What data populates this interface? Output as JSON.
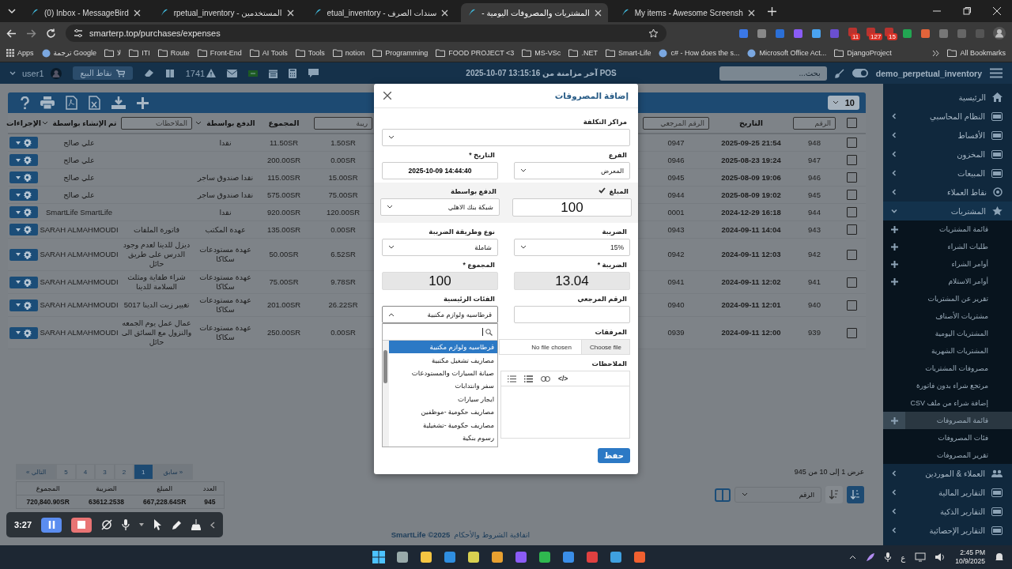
{
  "browser": {
    "tabs": [
      {
        "title": "My items - Awesome Screensh",
        "selected": false
      },
      {
        "title": "المشتريات والمصروفات اليومية -",
        "selected": true
      },
      {
        "title": "سندات الصرف - etual_inventory",
        "selected": false
      },
      {
        "title": "المستخدمين - rpetual_inventory",
        "selected": false
      },
      {
        "title": "(0) Inbox - MessageBird",
        "selected": false
      }
    ],
    "address": "smarterp.top/purchases/expenses",
    "extension_badges": [
      "15",
      "127",
      "11"
    ],
    "bookmarks": [
      {
        "label": "DjangoProject",
        "kind": "folder"
      },
      {
        "label": "Microsoft Office Act...",
        "kind": "site"
      },
      {
        "label": "c# - How does the s...",
        "kind": "site"
      },
      {
        "label": "Smart-Life",
        "kind": "folder"
      },
      {
        "label": ".NET",
        "kind": "folder"
      },
      {
        "label": "MS-VSc",
        "kind": "folder"
      },
      {
        "label": "FOOD PROJECT <3",
        "kind": "folder"
      },
      {
        "label": "Programming",
        "kind": "folder"
      },
      {
        "label": "notion",
        "kind": "folder"
      },
      {
        "label": "Tools",
        "kind": "folder"
      },
      {
        "label": "AI Tools",
        "kind": "folder"
      },
      {
        "label": "Front-End",
        "kind": "folder"
      },
      {
        "label": "Route",
        "kind": "folder"
      },
      {
        "label": "ITI",
        "kind": "folder"
      },
      {
        "label": "لا",
        "kind": "folder"
      },
      {
        "label": "ترجمة Google",
        "kind": "site"
      },
      {
        "label": "Apps",
        "kind": "apps"
      }
    ],
    "all_bookmarks": "All Bookmarks"
  },
  "header": {
    "company": "demo_perpetual_inventory",
    "toggle_on": true,
    "search_placeholder": "بحث...",
    "sync": "2025-10-07 13:15:16 آخر مزامنة من POS",
    "alert_count": "1741",
    "pos_button": "نقاط البيع",
    "user": "user1"
  },
  "sidebar": {
    "items": [
      {
        "label": "الرئيسية",
        "expandable": false,
        "expanded": false
      },
      {
        "label": "النظام المحاسبي",
        "expandable": true,
        "expanded": false
      },
      {
        "label": "الأقساط",
        "expandable": true,
        "expanded": false
      },
      {
        "label": "المخزون",
        "expandable": true,
        "expanded": false
      },
      {
        "label": "المبيعات",
        "expandable": true,
        "expanded": false
      },
      {
        "label": "نقاط العملاء",
        "expandable": true,
        "expanded": false
      },
      {
        "label": "المشتريات",
        "expandable": true,
        "expanded": true,
        "children": [
          {
            "label": "قائمة المشتريات",
            "add": true,
            "selected": false
          },
          {
            "label": "طلبات الشراء",
            "add": true,
            "selected": false
          },
          {
            "label": "أوامر الشراء",
            "add": true,
            "selected": false
          },
          {
            "label": "أوامر الاستلام",
            "add": true,
            "selected": false
          },
          {
            "label": "تقرير عن المشتريات",
            "add": false,
            "selected": false
          },
          {
            "label": "مشتريات الأصناف",
            "add": false,
            "selected": false
          },
          {
            "label": "المشتريات اليومية",
            "add": false,
            "selected": false
          },
          {
            "label": "المشتريات الشهرية",
            "add": false,
            "selected": false
          },
          {
            "label": "مصروفات المشتريات",
            "add": false,
            "selected": false
          },
          {
            "label": "مرتجع شراء بدون فاتورة",
            "add": false,
            "selected": false
          },
          {
            "label": "إضافة شراء من ملف CSV",
            "add": false,
            "selected": false
          },
          {
            "label": "قائمة المصروفات",
            "add": true,
            "selected": true
          },
          {
            "label": "فئات المصروفات",
            "add": false,
            "selected": false
          },
          {
            "label": "تقرير المصروفات",
            "add": false,
            "selected": false
          }
        ]
      },
      {
        "label": "العملاء & الموردين",
        "expandable": true,
        "expanded": false
      },
      {
        "label": "التقارير المالية",
        "expandable": true,
        "expanded": false
      },
      {
        "label": "التقارير الذكية",
        "expandable": true,
        "expanded": false
      },
      {
        "label": "التقارير الإحصائية",
        "expandable": true,
        "expanded": false
      }
    ]
  },
  "table": {
    "page_size": "10",
    "columns": [
      {
        "kind": "checkbox",
        "checked": false
      },
      {
        "placeholder": "الرقم",
        "kind": "filter"
      },
      {
        "label": "التاريخ",
        "kind": "plain"
      },
      {
        "placeholder": "الرقم المرجعي",
        "kind": "filter"
      },
      {
        "placeholder": "ريبة",
        "kind": "filter"
      },
      {
        "label": "المجموع",
        "kind": "plain"
      },
      {
        "label": "الدفع بواسطة",
        "kind": "select"
      },
      {
        "placeholder": "الملاحظات",
        "kind": "filter"
      },
      {
        "label": "تم الإنشاء بواسطة",
        "kind": "select"
      },
      {
        "label": "الإجراءات",
        "kind": "plain"
      }
    ],
    "rows": [
      {
        "checked": false,
        "number": "948",
        "date": "2025-09-25 21:54",
        "ref": "0947",
        "tax": "1.50SR",
        "total": "11.50SR",
        "payment": "نقدا",
        "created_by": "علي صالح"
      },
      {
        "checked": false,
        "number": "947",
        "date": "2025-08-23 19:24",
        "ref": "0946",
        "tax": "0.00SR",
        "total": "200.00SR",
        "created_by": "علي صالح"
      },
      {
        "checked": false,
        "number": "946",
        "date": "2025-08-09 19:06",
        "ref": "0945",
        "tax": "15.00SR",
        "total": "115.00SR",
        "payment": "نقدا صندوق ساجر",
        "created_by": "علي صالح"
      },
      {
        "checked": false,
        "number": "945",
        "date": "2025-08-09 19:02",
        "ref": "0944",
        "tax": "75.00SR",
        "total": "575.00SR",
        "payment": "نقدا صندوق ساجر",
        "created_by": "علي صالح"
      },
      {
        "checked": false,
        "number": "944",
        "date": "2024-12-29 16:18",
        "ref": "0001",
        "tax": "120.00SR",
        "total": "920.00SR",
        "payment": "نقدا",
        "created_by": "SmartLife SmartLife"
      },
      {
        "checked": false,
        "number": "943",
        "date": "2024-09-11 14:04",
        "ref": "0943",
        "tax": "0.00SR",
        "total": "135.00SR",
        "payment": "عهدة المكتب",
        "notes": "فاتورة الملفات",
        "created_by": "SARAH ALMAHMOUDI"
      },
      {
        "checked": false,
        "number": "942",
        "date": "2024-09-11 12:03",
        "ref": "0942",
        "tax": "6.52SR",
        "total": "50.00SR",
        "payment": "عهدة مستودعات سكاكا",
        "notes": "ديزل للدينا لعدم وجود الدرس على طريق حائل",
        "created_by": "SARAH ALMAHMOUDI"
      },
      {
        "checked": false,
        "number": "941",
        "date": "2024-09-11 12:02",
        "ref": "0941",
        "tax": "9.78SR",
        "total": "75.00SR",
        "payment": "عهدة مستودعات سكاكا",
        "notes": "شراء طفاية ومثلث السلامة للدينا",
        "created_by": "SARAH ALMAHMOUDI"
      },
      {
        "checked": false,
        "number": "940",
        "date": "2024-09-11 12:01",
        "ref": "0940",
        "tax": "26.22SR",
        "total": "201.00SR",
        "payment": "عهدة مستودعات سكاكا",
        "notes": "تغيير زيت الدينا 5017",
        "created_by": "SARAH ALMAHMOUDI"
      },
      {
        "checked": false,
        "number": "939",
        "date": "2024-09-11 12:00",
        "ref": "0939",
        "tax": "0.00SR",
        "total": "250.00SR",
        "payment": "عهدة مستودعات سكاكا",
        "notes": "عمال عمل يوم الجمعه والنزول مع السائق الى حائل",
        "created_by": "SARAH ALMAHMOUDI"
      }
    ],
    "info": "عرض 1 إلى 10 من 945",
    "pagination": [
      {
        "label": "« سابق",
        "selected": false
      },
      {
        "label": "1",
        "selected": true
      },
      {
        "label": "2",
        "selected": false
      },
      {
        "label": "3",
        "selected": false
      },
      {
        "label": "4",
        "selected": false
      },
      {
        "label": "5",
        "selected": false
      },
      {
        "label": "التالي »",
        "selected": false
      }
    ],
    "summary": {
      "headers": [
        "العدد",
        "المبلغ",
        "الضريبة",
        "المجموع"
      ],
      "values": [
        "945",
        "667,228.64SR",
        "63612.2538",
        "720,840.90SR"
      ]
    },
    "sort_by": "الرقم"
  },
  "footer": {
    "link": "اتفاقية الشروط والأحكام",
    "copyright": "SmartLife ©2025"
  },
  "modal": {
    "title": "إضافة المصروفات",
    "cost_center": {
      "label": "مراكز التكلفة"
    },
    "branch": {
      "label": "الفرع",
      "value": "المعرض"
    },
    "date": {
      "label": "التاريخ *",
      "value": "2025-10-09 14:44:40"
    },
    "amount": {
      "label": "المبلغ",
      "valid": true,
      "value": "100"
    },
    "payment": {
      "label": "الدفع بواسطة",
      "value": "شبكة بنك الاهلي"
    },
    "tax_rate": {
      "label": "الضريبة",
      "value": "15%"
    },
    "tax_type": {
      "label": "نوع وطريقة الضريبة",
      "value": "شاملة"
    },
    "tax": {
      "label": "الضريبة *",
      "value": "13.04"
    },
    "total": {
      "label": "المجموع *",
      "value": "100"
    },
    "reference": {
      "label": "الرقم المرجعي"
    },
    "category": {
      "label": "الفئات الرئيسية",
      "value": "قرطاسيه ولوازم مكتبية",
      "expanded": true,
      "options": [
        {
          "label": "قرطاسيه ولوازم مكتبية",
          "selected": true
        },
        {
          "label": "مصاريف تشغيل مكتبية",
          "selected": false
        },
        {
          "label": "صيانة السيارات والمستودعات",
          "selected": false
        },
        {
          "label": "سفر وانتدابات",
          "selected": false
        },
        {
          "label": "ايجار سيارات",
          "selected": false
        },
        {
          "label": "مصاريف حكومية -موظفين",
          "selected": false
        },
        {
          "label": "مصاريف حكومية -تشغيلية",
          "selected": false
        },
        {
          "label": "رسوم بنكية",
          "selected": false
        }
      ]
    },
    "attachments": {
      "label": "المرفقات",
      "button": "Choose file",
      "status": "No file chosen"
    },
    "notes": {
      "label": "الملاحظات",
      "code_button": "</>"
    },
    "save": "حفظ"
  },
  "recorder": {
    "time": "3:27"
  },
  "taskbar": {
    "language": "ع",
    "time": "2:45 PM",
    "date": "10/9/2025"
  }
}
